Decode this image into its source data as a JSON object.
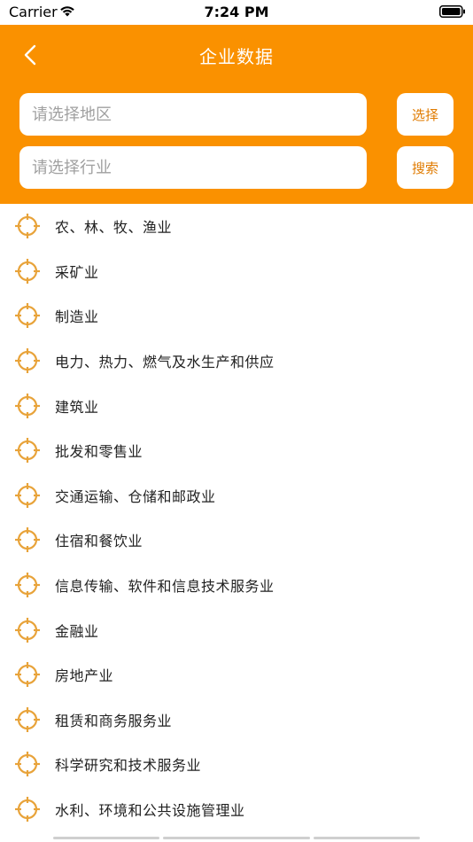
{
  "status_bar": {
    "carrier": "Carrier",
    "time": "7:24 PM"
  },
  "header": {
    "title": "企业数据",
    "back_icon": "chevron-left-icon",
    "region_placeholder": "请选择地区",
    "industry_placeholder": "请选择行业",
    "select_label": "选择",
    "search_label": "搜索"
  },
  "colors": {
    "accent": "#fa9100",
    "button_text": "#e07b00",
    "icon": "#e8a33a"
  },
  "industries": [
    "农、林、牧、渔业",
    "采矿业",
    "制造业",
    "电力、热力、燃气及水生产和供应",
    "建筑业",
    "批发和零售业",
    "交通运输、仓储和邮政业",
    "住宿和餐饮业",
    "信息传输、软件和信息技术服务业",
    "金融业",
    "房地产业",
    "租赁和商务服务业",
    "科学研究和技术服务业",
    "水利、环境和公共设施管理业"
  ],
  "item_icon": "target-crosshair-icon"
}
